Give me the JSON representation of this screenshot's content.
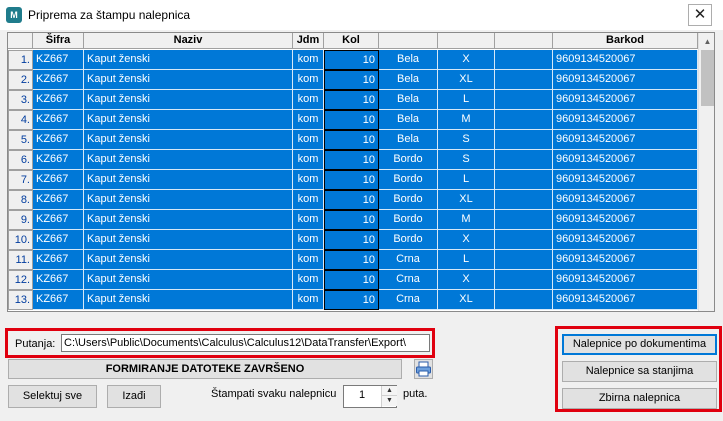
{
  "window": {
    "app_icon_text": "M",
    "title": "Priprema za štampu nalepnica",
    "close_glyph": "✕"
  },
  "grid": {
    "columns": [
      "",
      "Šifra",
      "Naziv",
      "Jdm",
      "Kol",
      "",
      "",
      "",
      "Barkod"
    ],
    "rows": [
      {
        "num": "1.",
        "sifra": "KZ667",
        "naziv": "Kaput ženski",
        "jdm": "kom",
        "kol": "10",
        "boja": "Bela",
        "velicina": "X",
        "extra": "",
        "barkod": "9609134520067"
      },
      {
        "num": "2.",
        "sifra": "KZ667",
        "naziv": "Kaput ženski",
        "jdm": "kom",
        "kol": "10",
        "boja": "Bela",
        "velicina": "XL",
        "extra": "",
        "barkod": "9609134520067"
      },
      {
        "num": "3.",
        "sifra": "KZ667",
        "naziv": "Kaput ženski",
        "jdm": "kom",
        "kol": "10",
        "boja": "Bela",
        "velicina": "L",
        "extra": "",
        "barkod": "9609134520067"
      },
      {
        "num": "4.",
        "sifra": "KZ667",
        "naziv": "Kaput ženski",
        "jdm": "kom",
        "kol": "10",
        "boja": "Bela",
        "velicina": "M",
        "extra": "",
        "barkod": "9609134520067"
      },
      {
        "num": "5.",
        "sifra": "KZ667",
        "naziv": "Kaput ženski",
        "jdm": "kom",
        "kol": "10",
        "boja": "Bela",
        "velicina": "S",
        "extra": "",
        "barkod": "9609134520067"
      },
      {
        "num": "6.",
        "sifra": "KZ667",
        "naziv": "Kaput ženski",
        "jdm": "kom",
        "kol": "10",
        "boja": "Bordo",
        "velicina": "S",
        "extra": "",
        "barkod": "9609134520067"
      },
      {
        "num": "7.",
        "sifra": "KZ667",
        "naziv": "Kaput ženski",
        "jdm": "kom",
        "kol": "10",
        "boja": "Bordo",
        "velicina": "L",
        "extra": "",
        "barkod": "9609134520067"
      },
      {
        "num": "8.",
        "sifra": "KZ667",
        "naziv": "Kaput ženski",
        "jdm": "kom",
        "kol": "10",
        "boja": "Bordo",
        "velicina": "XL",
        "extra": "",
        "barkod": "9609134520067"
      },
      {
        "num": "9.",
        "sifra": "KZ667",
        "naziv": "Kaput ženski",
        "jdm": "kom",
        "kol": "10",
        "boja": "Bordo",
        "velicina": "M",
        "extra": "",
        "barkod": "9609134520067"
      },
      {
        "num": "10.",
        "sifra": "KZ667",
        "naziv": "Kaput ženski",
        "jdm": "kom",
        "kol": "10",
        "boja": "Bordo",
        "velicina": "X",
        "extra": "",
        "barkod": "9609134520067"
      },
      {
        "num": "11.",
        "sifra": "KZ667",
        "naziv": "Kaput ženski",
        "jdm": "kom",
        "kol": "10",
        "boja": "Crna",
        "velicina": "L",
        "extra": "",
        "barkod": "9609134520067"
      },
      {
        "num": "12.",
        "sifra": "KZ667",
        "naziv": "Kaput ženski",
        "jdm": "kom",
        "kol": "10",
        "boja": "Crna",
        "velicina": "X",
        "extra": "",
        "barkod": "9609134520067"
      },
      {
        "num": "13.",
        "sifra": "KZ667",
        "naziv": "Kaput ženski",
        "jdm": "kom",
        "kol": "10",
        "boja": "Crna",
        "velicina": "XL",
        "extra": "",
        "barkod": "9609134520067"
      }
    ]
  },
  "path": {
    "label": "Putanja:",
    "value": "C:\\Users\\Public\\Documents\\Calculus\\Calculus12\\DataTransfer\\Export\\"
  },
  "actions": {
    "formiranje_label": "FORMIRANJE DATOTEKE ZAVRŠENO",
    "print_icon": "printer-icon",
    "selektuj_label": "Selektuj sve",
    "izadji_label": "Izađi",
    "stampati_label": "Štampati svaku nalepnicu",
    "copies_value": "1",
    "puta_label": "puta."
  },
  "right_buttons": {
    "po_dokumentima": "Nalepnice po dokumentima",
    "sa_stanjima": "Nalepnice sa stanjima",
    "zbirna": "Zbirna nalepnica"
  },
  "colors": {
    "selection": "#0078d7",
    "highlight_border": "#e0000f"
  }
}
